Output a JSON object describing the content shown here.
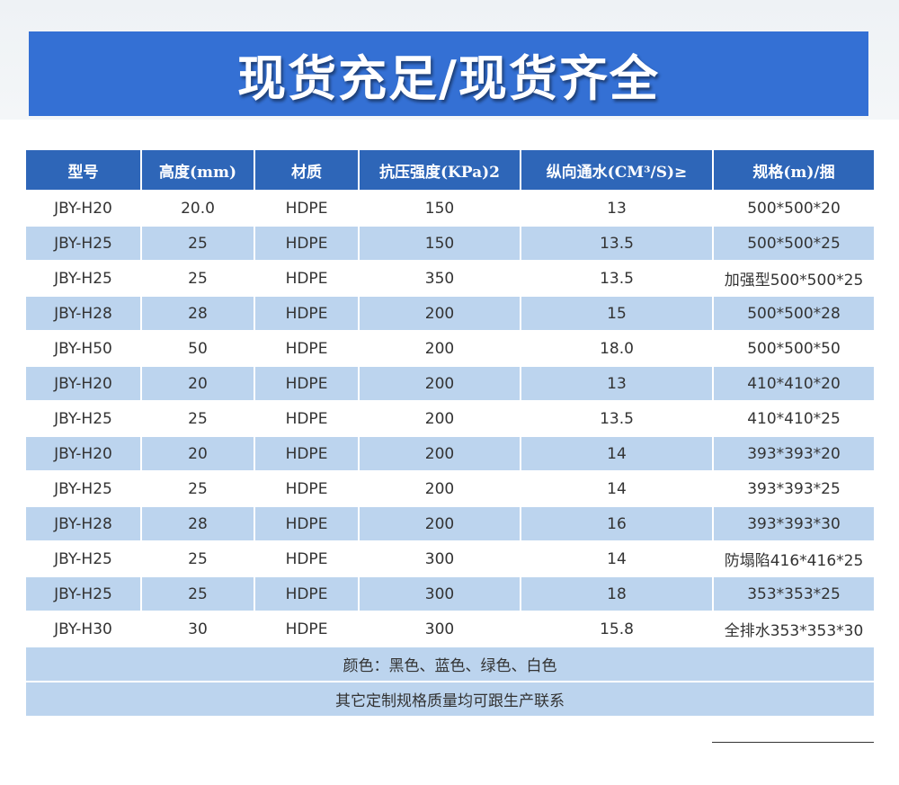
{
  "banner": {
    "title": "现货充足/现货齐全"
  },
  "table": {
    "headers": [
      "型号",
      "高度(mm)",
      "材质",
      "抗压强度(KPa)2",
      "纵向通水(CM³/S)≥",
      "规格(m)/捆"
    ],
    "rows": [
      [
        "JBY-H20",
        "20.0",
        "HDPE",
        "150",
        "13",
        "500*500*20"
      ],
      [
        "JBY-H25",
        "25",
        "HDPE",
        "150",
        "13.5",
        "500*500*25"
      ],
      [
        "JBY-H25",
        "25",
        "HDPE",
        "350",
        "13.5",
        "加强型500*500*25"
      ],
      [
        "JBY-H28",
        "28",
        "HDPE",
        "200",
        "15",
        "500*500*28"
      ],
      [
        "JBY-H50",
        "50",
        "HDPE",
        "200",
        "18.0",
        "500*500*50"
      ],
      [
        "JBY-H20",
        "20",
        "HDPE",
        "200",
        "13",
        "410*410*20"
      ],
      [
        "JBY-H25",
        "25",
        "HDPE",
        "200",
        "13.5",
        "410*410*25"
      ],
      [
        "JBY-H20",
        "20",
        "HDPE",
        "200",
        "14",
        "393*393*20"
      ],
      [
        "JBY-H25",
        "25",
        "HDPE",
        "200",
        "14",
        "393*393*25"
      ],
      [
        "JBY-H28",
        "28",
        "HDPE",
        "200",
        "16",
        "393*393*30"
      ],
      [
        "JBY-H25",
        "25",
        "HDPE",
        "300",
        "14",
        "防塌陷416*416*25"
      ],
      [
        "JBY-H25",
        "25",
        "HDPE",
        "300",
        "18",
        "353*353*25"
      ],
      [
        "JBY-H30",
        "30",
        "HDPE",
        "300",
        "15.8",
        "全排水353*353*30"
      ]
    ],
    "footer": [
      "颜色：黑色、蓝色、绿色、白色",
      "其它定制规格质量均可跟生产联系"
    ]
  },
  "colors": {
    "banner": "#3470d4",
    "header": "#2e66b8",
    "stripe": "#bcd4ee"
  }
}
